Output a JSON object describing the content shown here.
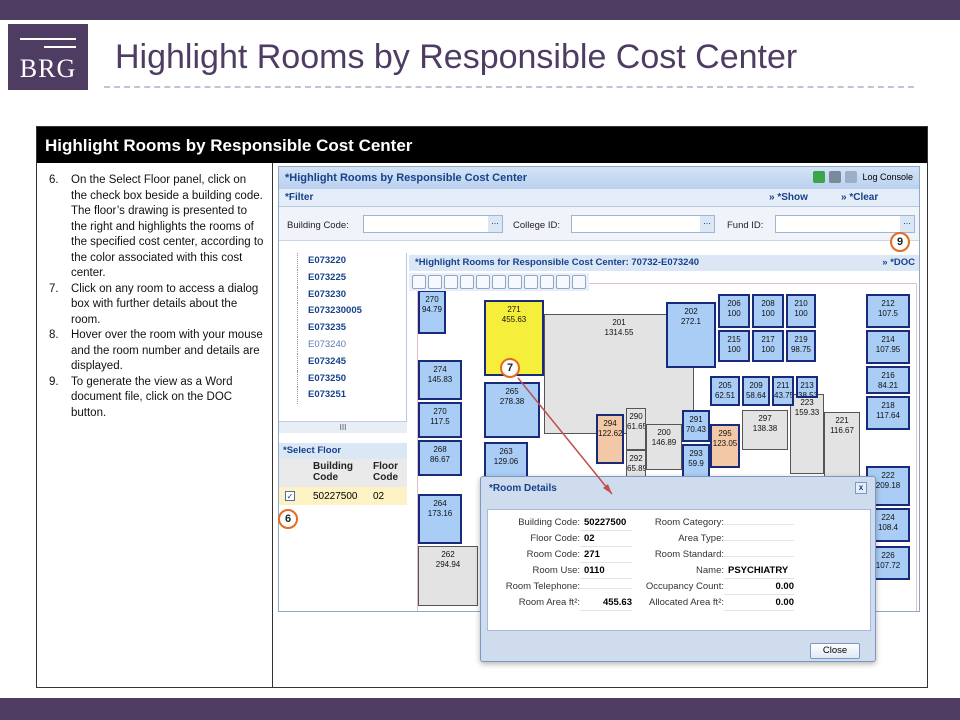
{
  "slide": {
    "logo_text": "BRG",
    "title": "Highlight Rooms by Responsible Cost Center"
  },
  "panel": {
    "heading": "Highlight Rooms by Responsible Cost Center",
    "steps": [
      {
        "num": "6.",
        "text": "On the Select Floor panel, click on the check box beside a building code.  The floor’s drawing is presented to the right and highlights the rooms of the specified cost center, according to the color associated with this cost center."
      },
      {
        "num": "7.",
        "text": "Click on any room to access a dialog box with further details about the room."
      },
      {
        "num": "8.",
        "text": "Hover over the room with your mouse and the room number and details are displayed."
      },
      {
        "num": "9.",
        "text": "To generate the view as a Word document file, click on the DOC button."
      }
    ]
  },
  "app": {
    "title": "*Highlight Rooms by Responsible Cost Center",
    "log_console": "Log Console",
    "filter": {
      "label": "*Filter",
      "show": "» *Show",
      "clear": "» *Clear",
      "building_code_label": "Building Code:",
      "college_id_label": "College ID:",
      "fund_id_label": "Fund ID:",
      "ellipsis": "..."
    },
    "tree": {
      "items": [
        "E073220",
        "E073225",
        "E073230",
        "E073230005",
        "E073235",
        "E073240",
        "E073245",
        "E073250",
        "E073251"
      ],
      "scroll": "III"
    },
    "select_floor": {
      "title": "*Select Floor",
      "col_building": "Building Code",
      "col_floor": "Floor Code",
      "row_building": "50227500",
      "row_floor": "02",
      "check": "✓"
    },
    "drawing": {
      "title": "*Highlight Rooms for Responsible Cost Center: 70732-E073240",
      "doc": "» *DOC",
      "rooms": [
        {
          "n": "270",
          "a": "94.79"
        },
        {
          "n": "271",
          "a": "455.63"
        },
        {
          "n": "201",
          "a": "1314.55"
        },
        {
          "n": "202",
          "a": "272.1"
        },
        {
          "n": "206",
          "a": "100"
        },
        {
          "n": "208",
          "a": "100"
        },
        {
          "n": "210",
          "a": "100"
        },
        {
          "n": "212",
          "a": "107.5"
        },
        {
          "n": "215",
          "a": "100"
        },
        {
          "n": "217",
          "a": "100"
        },
        {
          "n": "219",
          "a": "98.75"
        },
        {
          "n": "214",
          "a": "107.95"
        },
        {
          "n": "274",
          "a": "145.83"
        },
        {
          "n": "216",
          "a": "84.21"
        },
        {
          "n": "265",
          "a": "278.38"
        },
        {
          "n": "218",
          "a": "117.64"
        },
        {
          "n": "270",
          "a": "117.5"
        },
        {
          "n": "268",
          "a": "86.67"
        },
        {
          "n": "263",
          "a": "129.06"
        },
        {
          "n": "200",
          "a": "146.89"
        },
        {
          "n": "290",
          "a": "61.65"
        },
        {
          "n": "292",
          "a": "65.89"
        },
        {
          "n": "291",
          "a": "70.43"
        },
        {
          "n": "293",
          "a": "59.9"
        },
        {
          "n": "294",
          "a": "122.62"
        },
        {
          "n": "295",
          "a": "123.05"
        },
        {
          "n": "297",
          "a": "138.38"
        },
        {
          "n": "223",
          "a": "159.33"
        },
        {
          "n": "221",
          "a": "116.67"
        },
        {
          "n": "205",
          "a": "62.51"
        },
        {
          "n": "209",
          "a": "58.64"
        },
        {
          "n": "211",
          "a": "43.75"
        },
        {
          "n": "213",
          "a": "38.53"
        },
        {
          "n": "222",
          "a": "209.18"
        },
        {
          "n": "264",
          "a": "173.16"
        },
        {
          "n": "224",
          "a": "108.4"
        },
        {
          "n": "262",
          "a": "294.94"
        },
        {
          "n": "226",
          "a": "107.72"
        }
      ]
    }
  },
  "dialog": {
    "title": "*Room Details",
    "left": [
      {
        "k": "Building Code:",
        "v": "50227500"
      },
      {
        "k": "Floor Code:",
        "v": "02"
      },
      {
        "k": "Room Code:",
        "v": "271"
      },
      {
        "k": "Room Use:",
        "v": "0110"
      },
      {
        "k": "Room Telephone:",
        "v": ""
      },
      {
        "k": "Room Area ft²:",
        "v": "455.63"
      }
    ],
    "right": [
      {
        "k": "Room Category:",
        "v": ""
      },
      {
        "k": "Area Type:",
        "v": ""
      },
      {
        "k": "Room Standard:",
        "v": ""
      },
      {
        "k": "Name:",
        "v": "PSYCHIATRY"
      },
      {
        "k": "Occupancy Count:",
        "v": "0.00"
      },
      {
        "k": "Allocated Area ft²:",
        "v": "0.00"
      }
    ],
    "close_label": "Close",
    "x": "x"
  },
  "callouts": {
    "six": "6",
    "seven": "7",
    "nine": "9"
  },
  "colors": {
    "brand": "#4e3c62",
    "highlight": "#f5ee3b",
    "room_blue": "#a9cdf5",
    "callout": "#e66a1f"
  }
}
